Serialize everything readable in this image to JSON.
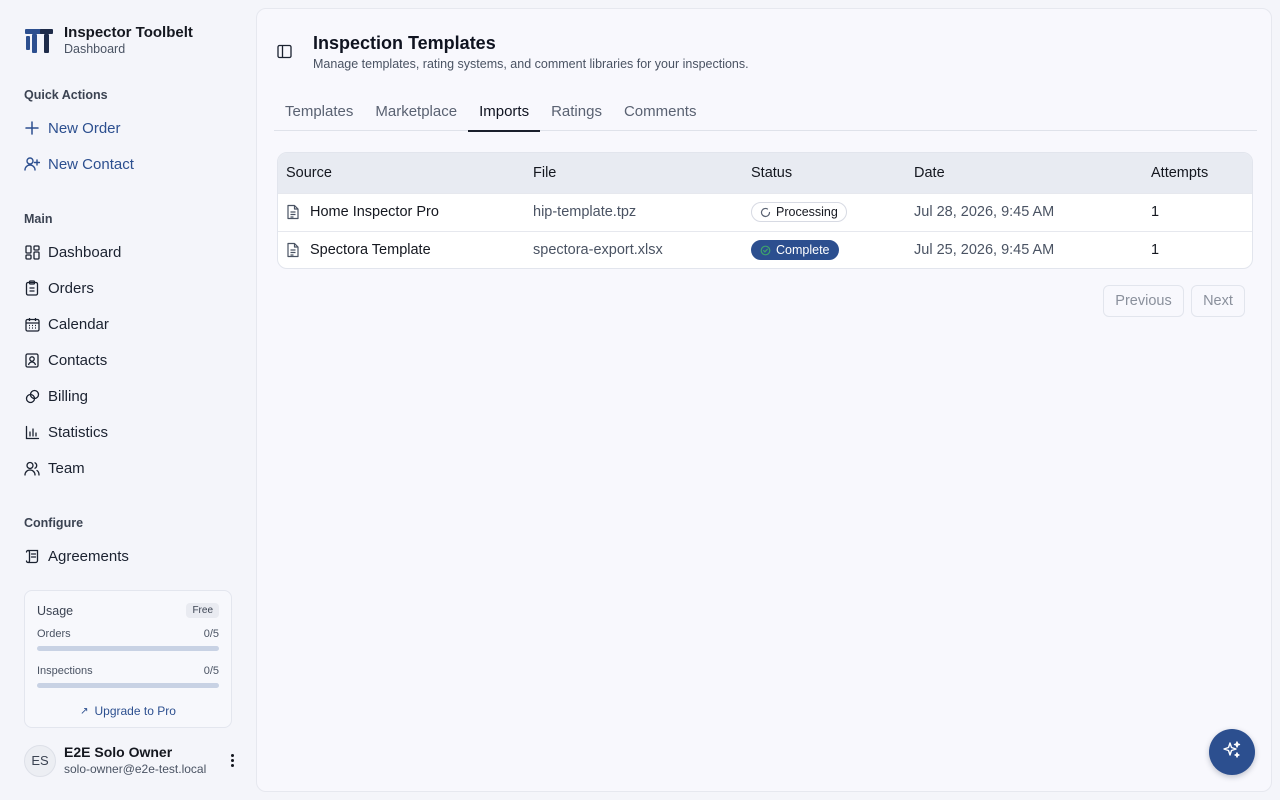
{
  "brand": {
    "title": "Inspector Toolbelt",
    "subtitle": "Dashboard",
    "logo_icon": "toolbelt-logo-icon"
  },
  "sidebar": {
    "quick_actions_label": "Quick Actions",
    "quick_actions": [
      {
        "label": "New Order",
        "icon": "plus-icon"
      },
      {
        "label": "New Contact",
        "icon": "user-plus-icon"
      }
    ],
    "main_label": "Main",
    "main_items": [
      {
        "label": "Dashboard",
        "icon": "dashboard-grid-icon"
      },
      {
        "label": "Orders",
        "icon": "clipboard-icon"
      },
      {
        "label": "Calendar",
        "icon": "calendar-icon"
      },
      {
        "label": "Contacts",
        "icon": "contact-card-icon"
      },
      {
        "label": "Billing",
        "icon": "coins-icon"
      },
      {
        "label": "Statistics",
        "icon": "bar-chart-icon"
      },
      {
        "label": "Team",
        "icon": "users-icon"
      }
    ],
    "configure_label": "Configure",
    "configure_items": [
      {
        "label": "Agreements",
        "icon": "scroll-icon"
      }
    ]
  },
  "usage": {
    "title": "Usage",
    "plan_badge": "Free",
    "orders_label": "Orders",
    "orders_value": "0/5",
    "orders_fraction": 0,
    "inspections_label": "Inspections",
    "inspections_value": "0/5",
    "inspections_fraction": 0,
    "upgrade_label": "Upgrade to Pro"
  },
  "user": {
    "initials": "ES",
    "name": "E2E Solo Owner",
    "email": "solo-owner@e2e-test.local"
  },
  "page": {
    "title": "Inspection Templates",
    "description": "Manage templates, rating systems, and comment libraries for your inspections."
  },
  "tabs": [
    {
      "label": "Templates",
      "active": false
    },
    {
      "label": "Marketplace",
      "active": false
    },
    {
      "label": "Imports",
      "active": true
    },
    {
      "label": "Ratings",
      "active": false
    },
    {
      "label": "Comments",
      "active": false
    }
  ],
  "table": {
    "columns": [
      "Source",
      "File",
      "Status",
      "Date",
      "Attempts"
    ],
    "rows": [
      {
        "source": "Home Inspector Pro",
        "file": "hip-template.tpz",
        "status": "Processing",
        "date": "Jul 28, 2026, 9:45 AM",
        "attempts": "1"
      },
      {
        "source": "Spectora Template",
        "file": "spectora-export.xlsx",
        "status": "Complete",
        "date": "Jul 25, 2026, 9:45 AM",
        "attempts": "1"
      }
    ]
  },
  "pagination": {
    "previous_label": "Previous",
    "next_label": "Next"
  },
  "colors": {
    "accent": "#2c4f8f",
    "background": "#f4f5fa",
    "panel": "#f8f8fd"
  }
}
